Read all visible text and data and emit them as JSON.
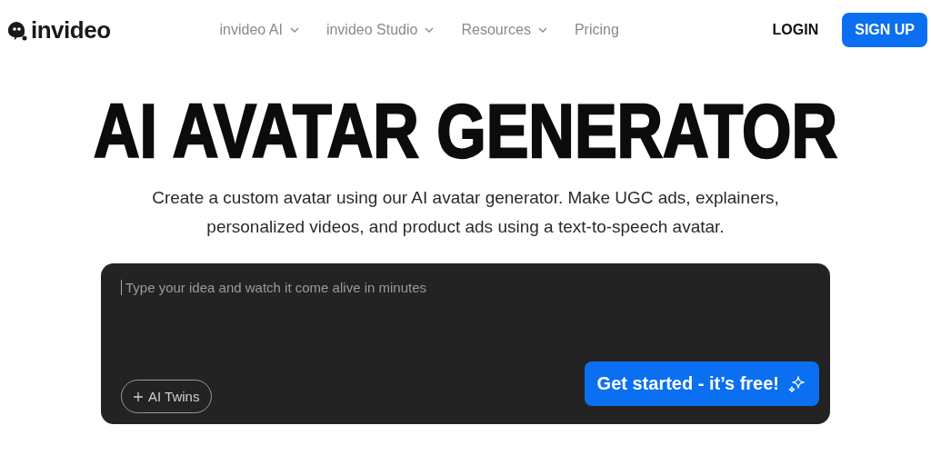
{
  "header": {
    "logo": "invideo",
    "nav": [
      {
        "label": "invideo AI",
        "dropdown": true
      },
      {
        "label": "invideo Studio",
        "dropdown": true
      },
      {
        "label": "Resources",
        "dropdown": true
      },
      {
        "label": "Pricing",
        "dropdown": false
      }
    ],
    "login": "LOGIN",
    "signup": "SIGN UP"
  },
  "hero": {
    "title": "AI AVATAR GENERATOR",
    "subtitle": "Create a custom avatar using our AI avatar generator. Make UGC ads, explainers, personalized videos, and product ads using a text-to-speech avatar."
  },
  "prompt": {
    "placeholder": "Type your idea and watch it come alive in minutes",
    "chip": "AI Twins",
    "cta": "Get started - it’s free!"
  }
}
